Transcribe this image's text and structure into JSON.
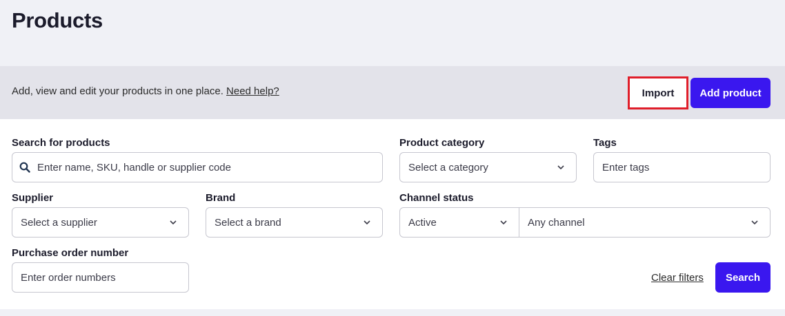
{
  "page": {
    "title": "Products"
  },
  "banner": {
    "text": "Add, view and edit your products in one place.",
    "help_link": "Need help?",
    "import_label": "Import",
    "add_label": "Add product"
  },
  "filters": {
    "search": {
      "label": "Search for products",
      "placeholder": "Enter name, SKU, handle or supplier code"
    },
    "category": {
      "label": "Product category",
      "placeholder": "Select a category"
    },
    "tags": {
      "label": "Tags",
      "placeholder": "Enter tags"
    },
    "supplier": {
      "label": "Supplier",
      "placeholder": "Select a supplier"
    },
    "brand": {
      "label": "Brand",
      "placeholder": "Select a brand"
    },
    "channel_status": {
      "label": "Channel status",
      "status_value": "Active",
      "channel_value": "Any channel"
    },
    "purchase_order": {
      "label": "Purchase order number",
      "placeholder": "Enter order numbers"
    },
    "clear_label": "Clear filters",
    "search_label": "Search"
  },
  "colors": {
    "accent": "#3a17ef",
    "highlight": "#e01e2a"
  },
  "icons": {
    "search": "search-icon",
    "dropdown": "chevron-down-icon"
  }
}
